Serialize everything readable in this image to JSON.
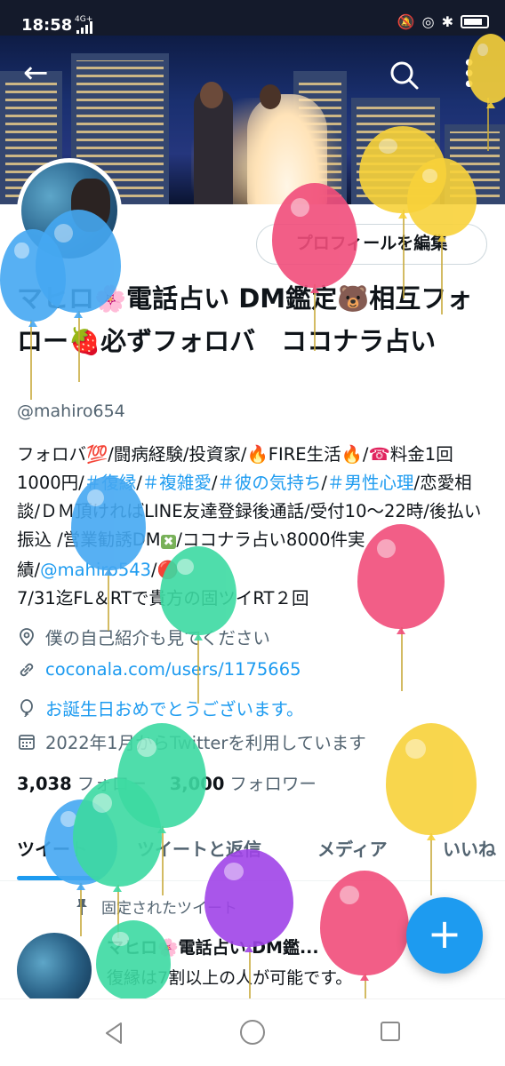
{
  "status_bar": {
    "time": "18:58",
    "network": "4G+"
  },
  "header": {
    "back_glyph": "←",
    "more_glyph": "⋮"
  },
  "profile": {
    "edit_button": "プロフィールを編集",
    "name": "マヒロ🌸電話占い DM鑑定🐻相互フォロー🍓必ずフォロバ　ココナラ占い",
    "handle": "@mahiro654",
    "bio": {
      "p1": "フォロバ💯/闘病経験/投資家/",
      "fire1": "🔥",
      "p2": "FIRE生活",
      "fire2": "🔥",
      "p3": "/",
      "phone": "☎",
      "p4": "料金1回 1000円/",
      "tag1": "＃復縁",
      "sep1": "/",
      "tag2": "＃複雑愛",
      "sep2": "/",
      "tag3": "＃彼の気持ち",
      "sep3": "/",
      "tag4": "＃男性心理",
      "p5": "/恋愛相談/ＤＭ頂ければLINE友達登録後通話/受付10〜22時/後払い振込 /営業勧誘DM",
      "cross": "✖",
      "p6": "/ココナラ占い8000件実績/",
      "mention": "@mahiro543",
      "p7": "/",
      "dot": "🔴",
      "p8": "7/31迄FL＆RTで貴方の固ツイRT２回"
    },
    "location": "僕の自己紹介も見てください",
    "website": "coconala.com/users/1175665",
    "birthday": "お誕生日おめでとうございます。",
    "joined": "2022年1月からTwitterを利用しています",
    "following_count": "3,038",
    "following_label": "フォロー",
    "followers_count": "3,000",
    "followers_label": "フォロワー"
  },
  "icons": {
    "location": "location-pin-icon",
    "link": "link-icon",
    "birthday": "balloon-icon",
    "calendar": "calendar-icon"
  },
  "tabs": [
    "ツイート",
    "ツイートと返信",
    "メディア",
    "いいね"
  ],
  "pinned_tweet": {
    "label": "固定されたツイート",
    "name": "マヒロ🌸電話占い DM鑑...",
    "text": "復縁は7割以上の人が可能です。"
  },
  "fab_label": "+",
  "balloon_colors": {
    "yellow": "#f8d23a",
    "pink": "#f14d7b",
    "blue": "#45a8f2",
    "green": "#3ddaa2",
    "purple": "#a044e8"
  }
}
